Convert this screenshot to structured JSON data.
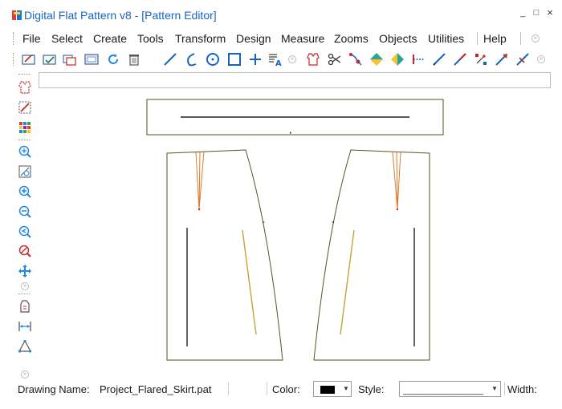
{
  "window": {
    "title": "Digital Flat Pattern v8 - [Pattern Editor]",
    "minimize": "_",
    "maximize": "□",
    "close": "×"
  },
  "menu": [
    "File",
    "Select",
    "Create",
    "Tools",
    "Transform",
    "Design",
    "Measure",
    "Zooms",
    "Objects",
    "Utilities",
    "Help"
  ],
  "toolbar_more": "»",
  "toolbar_icons": [
    "new-pattern-icon",
    "open-pattern-icon",
    "print-icon",
    "display-icon",
    "refresh-icon",
    "trash-icon",
    "line-icon",
    "curve-icon",
    "circle-icon",
    "rectangle-icon",
    "plus-icon",
    "text-icon",
    "blouse-icon",
    "scissors-icon",
    "node-icon",
    "diamond-v-icon",
    "diamond-h-icon",
    "measure-icon",
    "diagonal-line-icon",
    "diagonal-line-red-icon",
    "points-icon",
    "arrow-icon",
    "slash-line-icon"
  ],
  "sidebar_icons": [
    "select-piece-icon",
    "deselect-icon",
    "grid-color-icon",
    "zoom-extents-icon",
    "zoom-window-icon",
    "zoom-in-icon",
    "zoom-out-icon",
    "zoom-previous-icon",
    "no-zoom-icon",
    "pan-icon",
    "piece-info-icon",
    "width-measure-icon",
    "triangle-icon"
  ],
  "command_input": {
    "value": "",
    "placeholder": ""
  },
  "status": {
    "drawing_name_label": "Drawing Name:",
    "drawing_name": "Project_Flared_Skirt.pat",
    "color_label": "Color:",
    "color_value": "#000000",
    "style_label": "Style:",
    "style_value": "___________________...",
    "width_label": "Width:"
  },
  "colors": {
    "title": "#1565c0",
    "pattern_outline": "#4a5a20",
    "dart": "#e0792a",
    "grain_line": "#c9a038"
  }
}
